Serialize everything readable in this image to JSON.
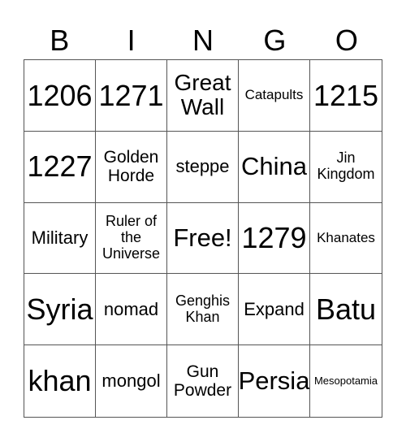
{
  "header": [
    "B",
    "I",
    "N",
    "G",
    "O"
  ],
  "cells": [
    {
      "text": "1206",
      "size": "xl"
    },
    {
      "text": "1271",
      "size": "xl"
    },
    {
      "text": "Great\nWall",
      "size": "l2"
    },
    {
      "text": "Catapults",
      "size": "s"
    },
    {
      "text": "1215",
      "size": "xl"
    },
    {
      "text": "1227",
      "size": "xl"
    },
    {
      "text": "Golden\nHorde",
      "size": "m2"
    },
    {
      "text": "steppe",
      "size": "m"
    },
    {
      "text": "China",
      "size": "l"
    },
    {
      "text": "Jin\nKingdom",
      "size": "s2"
    },
    {
      "text": "Military",
      "size": "m"
    },
    {
      "text": "Ruler of\nthe\nUniverse",
      "size": "s2"
    },
    {
      "text": "Free!",
      "size": "l"
    },
    {
      "text": "1279",
      "size": "xl"
    },
    {
      "text": "Khanates",
      "size": "s"
    },
    {
      "text": "Syria",
      "size": "xl"
    },
    {
      "text": "nomad",
      "size": "m"
    },
    {
      "text": "Genghis\nKhan",
      "size": "s2"
    },
    {
      "text": "Expand",
      "size": "m"
    },
    {
      "text": "Batu",
      "size": "xl"
    },
    {
      "text": "khan",
      "size": "xl"
    },
    {
      "text": "mongol",
      "size": "m"
    },
    {
      "text": "Gun\nPowder",
      "size": "m2"
    },
    {
      "text": "Persia",
      "size": "l"
    },
    {
      "text": "Mesopotamia",
      "size": "xs"
    }
  ]
}
